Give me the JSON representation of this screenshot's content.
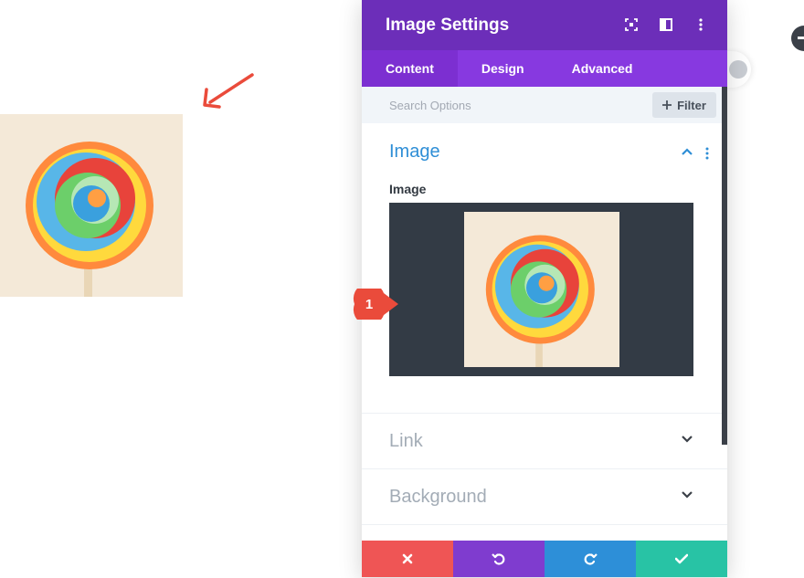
{
  "panel": {
    "title": "Image Settings",
    "tabs": [
      {
        "label": "Content",
        "active": true
      },
      {
        "label": "Design",
        "active": false
      },
      {
        "label": "Advanced",
        "active": false
      }
    ],
    "search_placeholder": "Search Options",
    "filter_label": "Filter",
    "sections": {
      "image": {
        "title": "Image",
        "expanded": true,
        "field_label": "Image"
      },
      "link": {
        "title": "Link",
        "expanded": false
      },
      "background": {
        "title": "Background",
        "expanded": false
      }
    },
    "header_icons": [
      "focus-icon",
      "split-view-icon",
      "more-vertical-icon"
    ],
    "footer_buttons": [
      {
        "name": "discard",
        "icon": "close-icon",
        "color": "#ef5555"
      },
      {
        "name": "undo",
        "icon": "undo-icon",
        "color": "#7f3ccf"
      },
      {
        "name": "redo",
        "icon": "redo-icon",
        "color": "#2d8fd8"
      },
      {
        "name": "save",
        "icon": "check-icon",
        "color": "#28c3a5"
      }
    ]
  },
  "annotation": {
    "badge_number": "1"
  },
  "colors": {
    "header": "#6c2eb9",
    "tabs": "#8739e0",
    "accent_blue": "#2e8ed6",
    "annotation_red": "#ea4b3b"
  }
}
